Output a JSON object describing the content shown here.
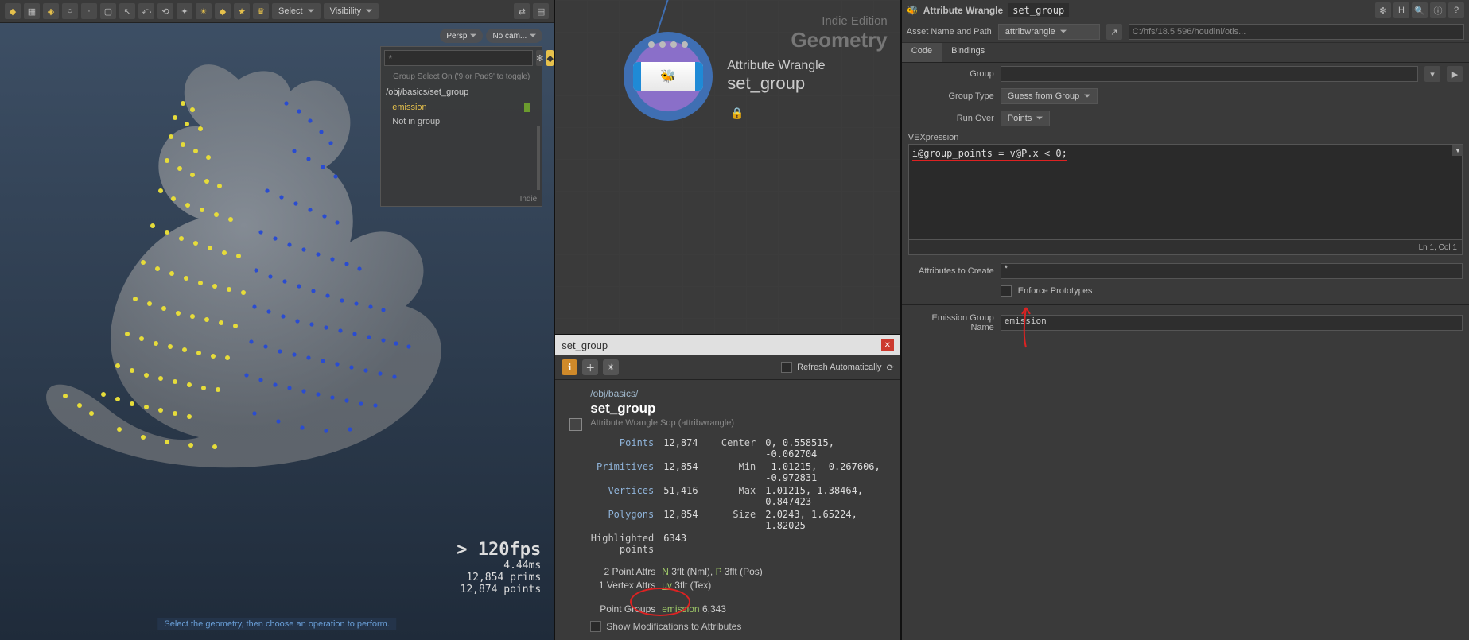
{
  "toolbar": {
    "select_label": "Select",
    "visibility_label": "Visibility"
  },
  "viewport": {
    "badge_persp": "Persp",
    "badge_cam": "No cam...",
    "group_hint": "Group Select On ('9 or Pad9' to toggle)",
    "group_path": "/obj/basics/set_group",
    "group_items": [
      "emission",
      "Not in group"
    ],
    "group_footer": "Indie",
    "fps": "> 120fps",
    "frame_ms": "4.44ms",
    "prims": "12,854  prims",
    "points": "12,874  points",
    "hint": "Select the geometry, then choose an operation to perform."
  },
  "network": {
    "watermark_top": "Indie Edition",
    "watermark_main": "Geometry",
    "node_type": "Attribute Wrangle",
    "node_name": "set_group"
  },
  "info": {
    "title": "set_group",
    "refresh": "Refresh Automatically",
    "path": "/obj/basics/",
    "name": "set_group",
    "type": "Attribute Wrangle Sop (attribwrangle)",
    "points": "12,874",
    "primitives": "12,854",
    "vertices": "51,416",
    "polygons": "12,854",
    "highlighted": "6343",
    "center": "0,  0.558515, -0.062704",
    "min": "-1.01215, -0.267606, -0.972831",
    "max": "1.01215,   1.38464,  0.847423",
    "size": "2.0243,   1.65224,   1.82025",
    "point_attrs": "2 Point Attrs",
    "point_attrs_v": "N 3flt (Nml), P 3flt (Pos)",
    "vertex_attrs": "1 Vertex Attrs",
    "vertex_attrs_v": "uv 3flt (Tex)",
    "point_groups": "Point Groups",
    "point_groups_name": "emission",
    "point_groups_count": "6,343",
    "show_mod": "Show Modifications to Attributes"
  },
  "params": {
    "header": "Attribute Wrangle",
    "header_name": "set_group",
    "asset_label": "Asset Name and Path",
    "asset_name": "attribwrangle",
    "asset_path": "C:/hfs/18.5.596/houdini/otls...",
    "tab_code": "Code",
    "tab_bind": "Bindings",
    "group_label": "Group",
    "group_value": "",
    "grouptype_label": "Group Type",
    "grouptype_value": "Guess from Group",
    "runover_label": "Run Over",
    "runover_value": "Points",
    "vex_label": "VEXpression",
    "vex_code": "i@group_points = v@P.x < 0;",
    "vex_status": "Ln 1, Col 1",
    "attrs_create_label": "Attributes to Create",
    "attrs_create_value": "*",
    "enforce_label": "Enforce Prototypes",
    "emission_label": "Emission Group Name",
    "emission_value": "emission"
  }
}
